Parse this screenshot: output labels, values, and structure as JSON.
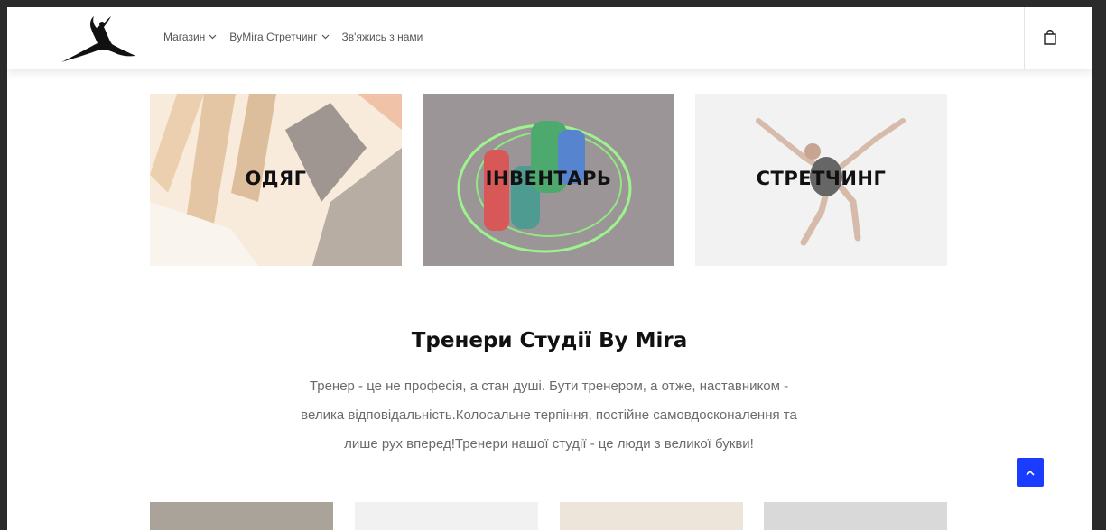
{
  "nav": {
    "items": [
      {
        "label": "Магазин",
        "has_dropdown": true
      },
      {
        "label": "ByMira Стретчинг",
        "has_dropdown": true
      },
      {
        "label": "Зв'яжись з нами",
        "has_dropdown": false
      }
    ]
  },
  "header": {
    "cart_icon": "shopping-bag-icon"
  },
  "categories": [
    {
      "label": "ОДЯГ"
    },
    {
      "label": "ІНВЕНТАРЬ"
    },
    {
      "label": "СТРЕТЧИНГ"
    }
  ],
  "section": {
    "title": "Тренери Студії By Mira",
    "text_lines": [
      "Тренер - це не професія, а стан душі. Бути тренером, а отже, наставником -",
      "велика відповідальність.Колосальне терпіння, постійне самовдосконалення та",
      "лише рух вперед!Тренери нашої студії - це люди з великої букви!"
    ]
  },
  "colors": {
    "accent": "#1a3cff",
    "nav_text": "#555555",
    "body_text": "#6b6b6b"
  }
}
